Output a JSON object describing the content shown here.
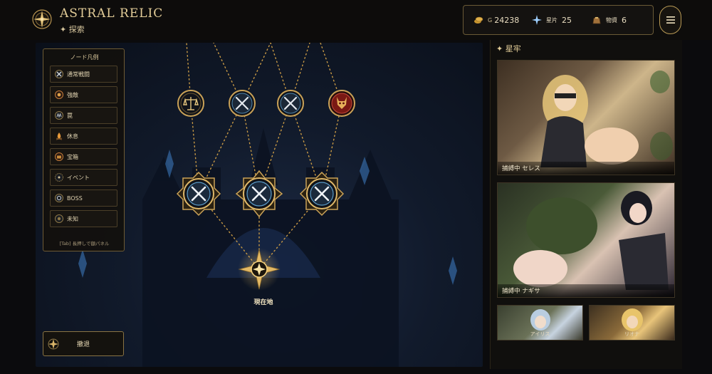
{
  "header": {
    "title": "ASTRAL RELIC",
    "subtitle": "✦ 探索",
    "resources": {
      "gold_prefix": "G",
      "gold_value": "24238",
      "star_label": "星片",
      "star_value": "25",
      "supply_label": "物資",
      "supply_value": "6"
    }
  },
  "legend": {
    "title": "ノード凡例",
    "items": [
      {
        "label": "通常戦闘",
        "icon": "swords-icon"
      },
      {
        "label": "強敵",
        "icon": "elite-icon"
      },
      {
        "label": "罠",
        "icon": "trap-icon"
      },
      {
        "label": "休息",
        "icon": "campfire-icon"
      },
      {
        "label": "宝箱",
        "icon": "chest-icon"
      },
      {
        "label": "イベント",
        "icon": "event-icon"
      },
      {
        "label": "BOSS",
        "icon": "boss-icon"
      },
      {
        "label": "未知",
        "icon": "unknown-icon"
      }
    ],
    "hint": "[Tab] 長押しで額パネル"
  },
  "map": {
    "current_label": "現在地",
    "nodes_top": [
      "balance-node-icon",
      "swords-node-icon",
      "swords-node-icon",
      "boss-node-icon"
    ],
    "nodes_mid": [
      "swords-node-icon",
      "swords-node-icon",
      "swords-node-icon"
    ],
    "retreat_label": "撤退"
  },
  "panel": {
    "title": "✦ 星牢",
    "captives": [
      {
        "caption": "捕縛中  セレス"
      },
      {
        "caption": "捕縛中  ナギサ"
      },
      {
        "caption": "アイリス"
      },
      {
        "caption": "リオナ"
      }
    ]
  },
  "colors": {
    "gold": "#d9b56a",
    "boss_red": "#8a1c18",
    "node_blue": "#4d86b0"
  }
}
